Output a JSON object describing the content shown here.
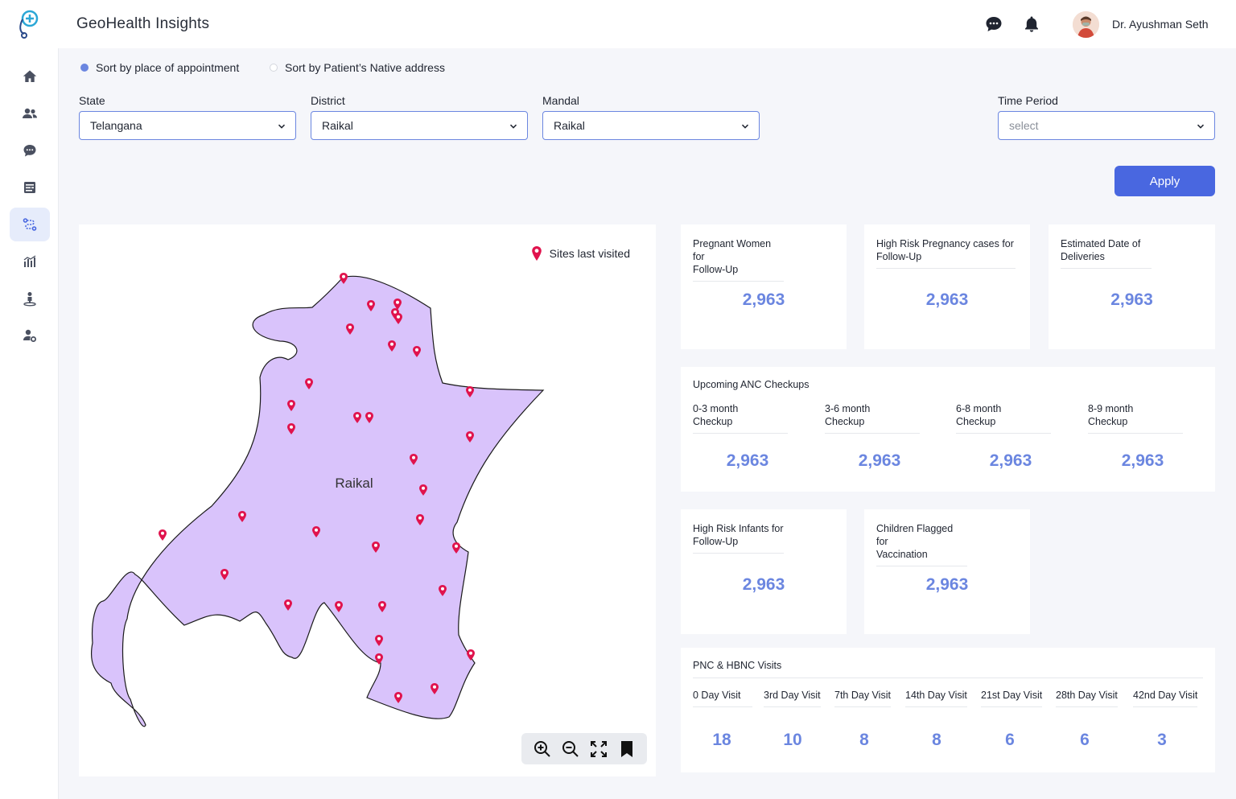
{
  "app": {
    "title": "GeoHealth Insights"
  },
  "header": {
    "user_name": "Dr. Ayushman Seth",
    "icons": [
      "chat-icon",
      "bell-icon"
    ]
  },
  "sidebar": {
    "items": [
      {
        "icon": "home-icon",
        "active": false
      },
      {
        "icon": "users-icon",
        "active": false
      },
      {
        "icon": "chat-icon",
        "active": false
      },
      {
        "icon": "records-icon",
        "active": false
      },
      {
        "icon": "geo-route-icon",
        "active": true
      },
      {
        "icon": "bar-chart-icon",
        "active": false
      },
      {
        "icon": "location-person-icon",
        "active": false
      },
      {
        "icon": "user-settings-icon",
        "active": false
      }
    ]
  },
  "sort": {
    "option1": "Sort by place of appointment",
    "option2": "Sort by Patient’s Native address",
    "selected": "option1"
  },
  "filters": {
    "state": {
      "label": "State",
      "value": "Telangana"
    },
    "district": {
      "label": "District",
      "value": "Raikal"
    },
    "mandal": {
      "label": "Mandal",
      "value": "Raikal"
    },
    "time_period": {
      "label": "Time Period",
      "placeholder": "select"
    }
  },
  "apply_label": "Apply",
  "map": {
    "region_label": "Raikal",
    "legend_label": "Sites last visited",
    "region_fill": "#d9c3fb",
    "marker_color": "#e0134d"
  },
  "stats": {
    "pregnant_women": {
      "title_line1": "Pregnant Women for",
      "title_line2": "Follow-Up",
      "value": "2,963"
    },
    "high_risk_pregnancy": {
      "title_line1": "High Risk Pregnancy cases for",
      "title_line2": "Follow-Up",
      "value": "2,963"
    },
    "delivery_dates": {
      "title_line1": "Estimated Date of",
      "title_line2": "Deliveries",
      "value": "2,963"
    },
    "anc": {
      "title": "Upcoming ANC Checkups",
      "items": [
        {
          "line1": "0-3 month",
          "line2": "Checkup",
          "value": "2,963"
        },
        {
          "line1": "3-6 month",
          "line2": "Checkup",
          "value": "2,963"
        },
        {
          "line1": "6-8 month",
          "line2": "Checkup",
          "value": "2,963"
        },
        {
          "line1": "8-9 month",
          "line2": "Checkup",
          "value": "2,963"
        }
      ]
    },
    "high_risk_infants": {
      "title_line1": "High Risk Infants for",
      "title_line2": "Follow-Up",
      "value": "2,963"
    },
    "children_vaccination": {
      "title_line1": "Children Flagged for",
      "title_line2": "Vaccination",
      "value": "2,963"
    },
    "pnc": {
      "title": "PNC & HBNC Visits",
      "visits": [
        {
          "label": "0 Day Visit",
          "value": "18"
        },
        {
          "label": "3rd Day Visit",
          "value": "10"
        },
        {
          "label": "7th Day Visit",
          "value": "8"
        },
        {
          "label": "14th Day Visit",
          "value": "8"
        },
        {
          "label": "21st Day Visit",
          "value": "6"
        },
        {
          "label": "28th Day Visit",
          "value": "6"
        },
        {
          "label": "42nd Day Visit",
          "value": "3"
        }
      ]
    }
  }
}
